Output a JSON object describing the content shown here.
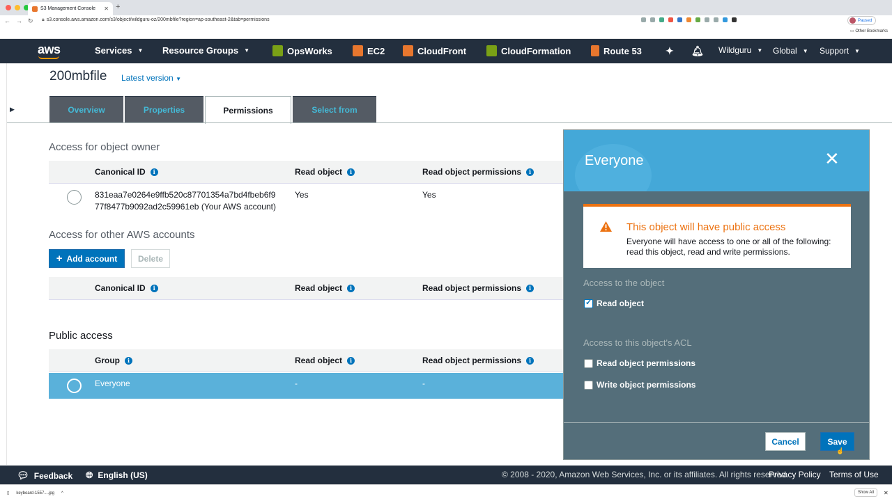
{
  "browser": {
    "tab_title": "S3 Management Console",
    "url": "s3.console.aws.amazon.com/s3/object/wildguru-oz/200mbfile?region=ap-southeast-2&tab=permissions",
    "paused_label": "Paused",
    "bookmarks_label": "Other Bookmarks"
  },
  "aws_nav": {
    "logo": "aws",
    "services": "Services",
    "resource_groups": "Resource Groups",
    "shortcuts": [
      {
        "label": "OpsWorks",
        "color": "#7aa116"
      },
      {
        "label": "EC2",
        "color": "#e8772e"
      },
      {
        "label": "CloudFront",
        "color": "#e8772e"
      },
      {
        "label": "CloudFormation",
        "color": "#7aa116"
      },
      {
        "label": "Route 53",
        "color": "#e8772e"
      }
    ],
    "account": "Wildguru",
    "region": "Global",
    "support": "Support"
  },
  "object": {
    "name": "200mbfile",
    "version_label": "Latest version"
  },
  "tabs": [
    {
      "label": "Overview"
    },
    {
      "label": "Properties"
    },
    {
      "label": "Permissions"
    },
    {
      "label": "Select from"
    }
  ],
  "owner_section": {
    "title": "Access for object owner",
    "headers": {
      "canonical_id": "Canonical ID",
      "read_object": "Read object",
      "read_perms": "Read object permissions"
    },
    "row": {
      "id_line1": "831eaa7e0264e9ffb520c87701354a7bd4fbeb6f9",
      "id_line2": "77f8477b9092ad2c59961eb (Your AWS account)",
      "read_object": "Yes",
      "read_perms": "Yes"
    }
  },
  "other_accounts": {
    "title": "Access for other AWS accounts",
    "add_button": "Add account",
    "delete_button": "Delete",
    "headers": {
      "canonical_id": "Canonical ID",
      "read_object": "Read object",
      "read_perms": "Read object permissions"
    }
  },
  "public_access": {
    "title": "Public access",
    "headers": {
      "group": "Group",
      "read_object": "Read object",
      "read_perms": "Read object permissions"
    },
    "row": {
      "group": "Everyone",
      "read_object": "-",
      "read_perms": "-"
    }
  },
  "panel": {
    "title": "Everyone",
    "alert_title": "This object will have public access",
    "alert_body": "Everyone will have access to one or all of the following: read this object, read and write permissions.",
    "object_access_label": "Access to the object",
    "read_object_label": "Read object",
    "read_object_checked": true,
    "acl_access_label": "Access to this object's ACL",
    "read_perms_label": "Read object permissions",
    "read_perms_checked": false,
    "write_perms_label": "Write object permissions",
    "write_perms_checked": false,
    "cancel_button": "Cancel",
    "save_button": "Save"
  },
  "footer": {
    "feedback": "Feedback",
    "language": "English (US)",
    "copyright": "© 2008 - 2020, Amazon Web Services, Inc. or its affiliates. All rights reserved.",
    "privacy": "Privacy Policy",
    "terms": "Terms of Use"
  },
  "downloads": {
    "file": "keyboard-1557....jpg",
    "show_all": "Show All"
  },
  "colors": {
    "nav_bg": "#232f3e",
    "link": "#0073bb",
    "panel_header": "#44a8d8",
    "panel_body": "#546e7a",
    "selected_row": "#5ab1da",
    "warning": "#ec7211"
  }
}
